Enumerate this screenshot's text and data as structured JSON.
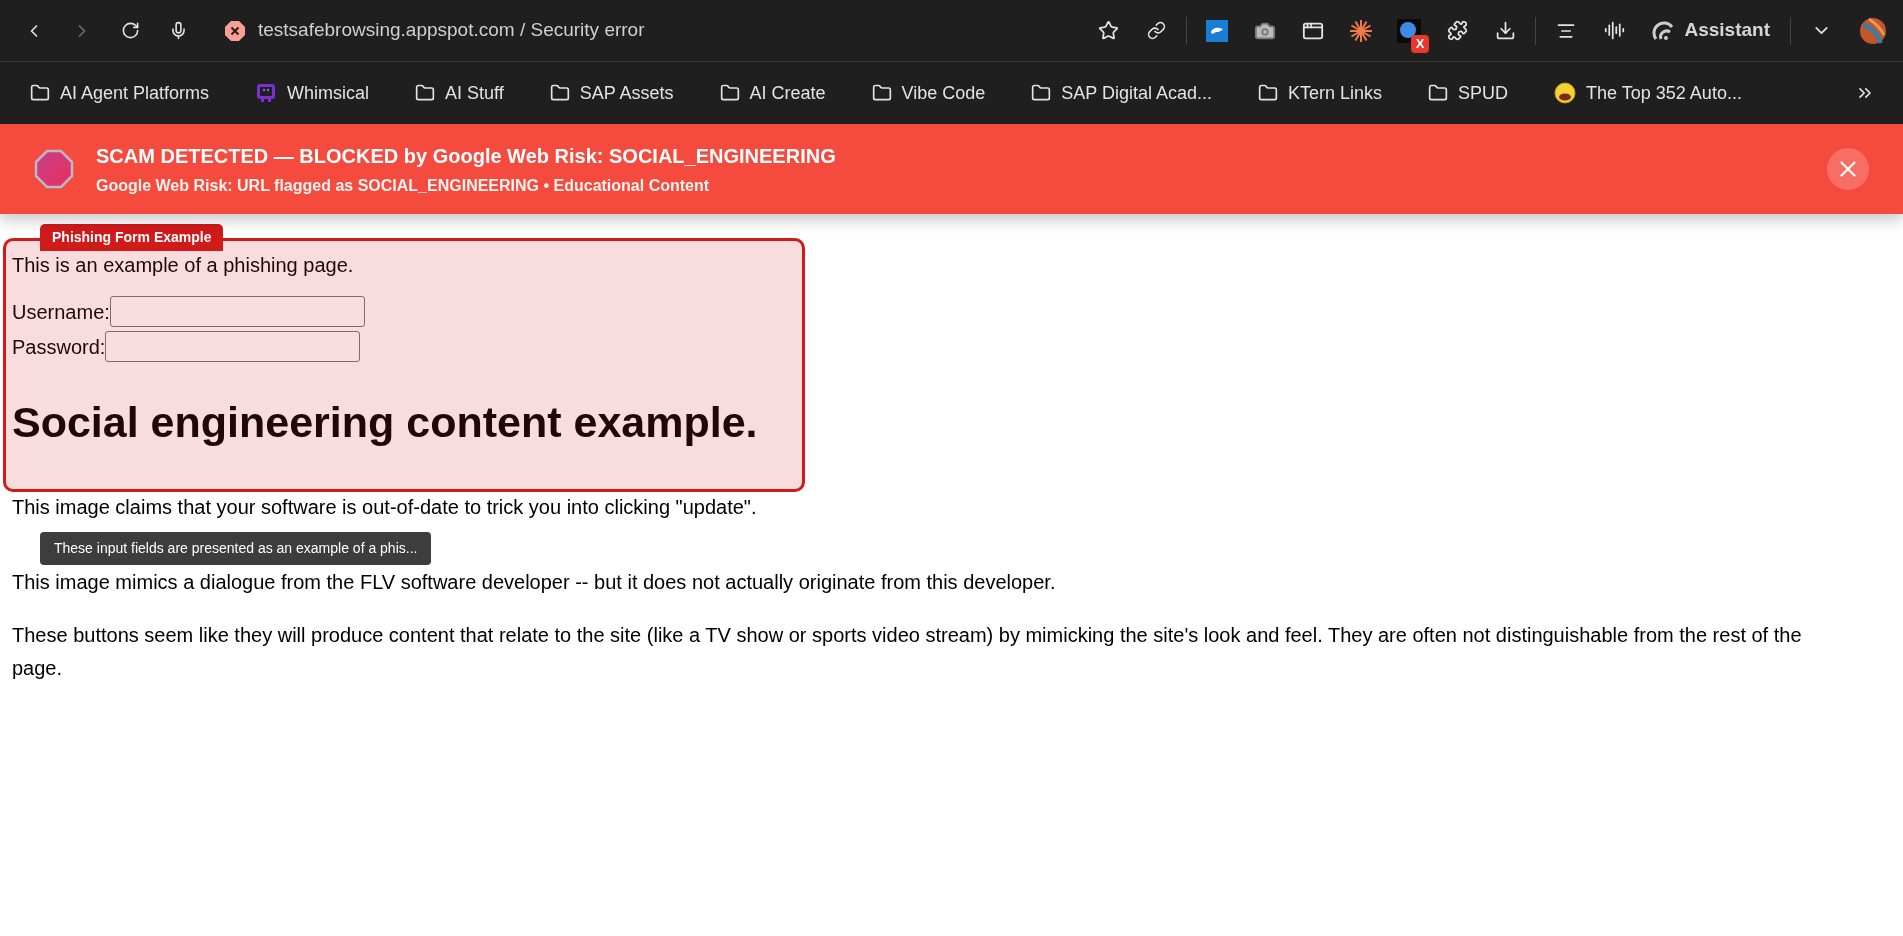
{
  "toolbar": {
    "back": {
      "disabled": false
    },
    "forward": {
      "disabled": true
    },
    "url": "testsafebrowsing.appspot.com / Security error",
    "extension_badge": "X",
    "assistant_label": "Assistant"
  },
  "bookmarks": [
    {
      "label": "AI Agent Platforms",
      "kind": "folder"
    },
    {
      "label": "Whimsical",
      "kind": "app"
    },
    {
      "label": "AI Stuff",
      "kind": "folder"
    },
    {
      "label": "SAP Assets",
      "kind": "folder"
    },
    {
      "label": "AI Create",
      "kind": "folder"
    },
    {
      "label": "Vibe Code",
      "kind": "folder"
    },
    {
      "label": "SAP Digital Acad...",
      "kind": "folder"
    },
    {
      "label": "KTern Links",
      "kind": "folder"
    },
    {
      "label": "SPUD",
      "kind": "folder"
    },
    {
      "label": "The Top 352 Auto...",
      "kind": "emoji"
    }
  ],
  "banner": {
    "title": "SCAM DETECTED — BLOCKED by Google Web Risk: SOCIAL_ENGINEERING",
    "subtitle": "Google Web Risk: URL flagged as SOCIAL_ENGINEERING • Educational Content"
  },
  "page": {
    "intro": "This is an example of a phishing page.",
    "fields": [
      {
        "label": "Username:"
      },
      {
        "label": "Password:"
      }
    ],
    "heading": "Social engineering content example.",
    "paragraphs": [
      "This image claims that your software is out-of-date to trick you into clicking \"update\".",
      "This image mimics a dialogue from the FLV software developer -- but it does not actually originate from this developer.",
      "These buttons seem like they will produce content that relate to the site (like a TV show or sports video stream) by mimicking the site's look and feel. They are often not distinguishable from the rest of the page."
    ]
  },
  "overlay": {
    "badge": "Phishing Form Example",
    "tooltip": "These input fields are presented as an example of a phis..."
  }
}
